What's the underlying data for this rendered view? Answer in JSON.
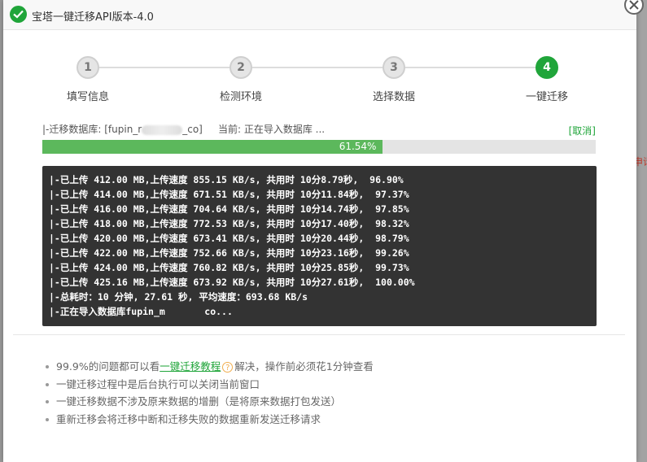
{
  "dialog": {
    "title": "宝塔一键迁移API版本-4.0"
  },
  "steps": [
    {
      "number": "1",
      "label": "填写信息"
    },
    {
      "number": "2",
      "label": "检测环境"
    },
    {
      "number": "3",
      "label": "选择数据"
    },
    {
      "number": "4",
      "label": "一键迁移"
    }
  ],
  "status": {
    "db_prefix": "|-迁移数据库: [fupin_r",
    "db_suffix": "_co]",
    "current": "当前: 正在导入数据库 ...",
    "cancel_label": "[取消]"
  },
  "progress": {
    "percent": 61.54,
    "label": "61.54%"
  },
  "log": [
    "|-已上传 412.00 MB,上传速度 855.15 KB/s, 共用时 10分8.79秒,  96.90%",
    "|-已上传 414.00 MB,上传速度 671.51 KB/s, 共用时 10分11.84秒,  97.37%",
    "|-已上传 416.00 MB,上传速度 704.64 KB/s, 共用时 10分14.74秒,  97.85%",
    "|-已上传 418.00 MB,上传速度 772.53 KB/s, 共用时 10分17.40秒,  98.32%",
    "|-已上传 420.00 MB,上传速度 673.41 KB/s, 共用时 10分20.44秒,  98.79%",
    "|-已上传 422.00 MB,上传速度 752.66 KB/s, 共用时 10分23.16秒,  99.26%",
    "|-已上传 424.00 MB,上传速度 760.82 KB/s, 共用时 10分25.85秒,  99.73%",
    "|-已上传 425.16 MB,上传速度 673.92 KB/s, 共用时 10分27.61秒,  100.00%",
    "|-总耗时：10 分钟, 27.61 秒, 平均速度：693.68 KB/s",
    "|-正在导入数据库fupin_m       co..."
  ],
  "tips": {
    "tip1_prefix": "99.9%的问题都可以看",
    "tip1_link": "一键迁移教程",
    "tip1_suffix": "解决，操作前必须花1分钟查看",
    "tip2": "一键迁移过程中是后台执行可以关闭当前窗口",
    "tip3": "一键迁移数据不涉及原来数据的增删（是将原来数据打包发送）",
    "tip4": "重新迁移会将迁移中断和迁移失败的数据重新发送迁移请求"
  },
  "colors": {
    "accent": "#20a53a",
    "progress": "#5cb85c",
    "log_bg": "#333333"
  },
  "background": {
    "right_text": "申请"
  }
}
